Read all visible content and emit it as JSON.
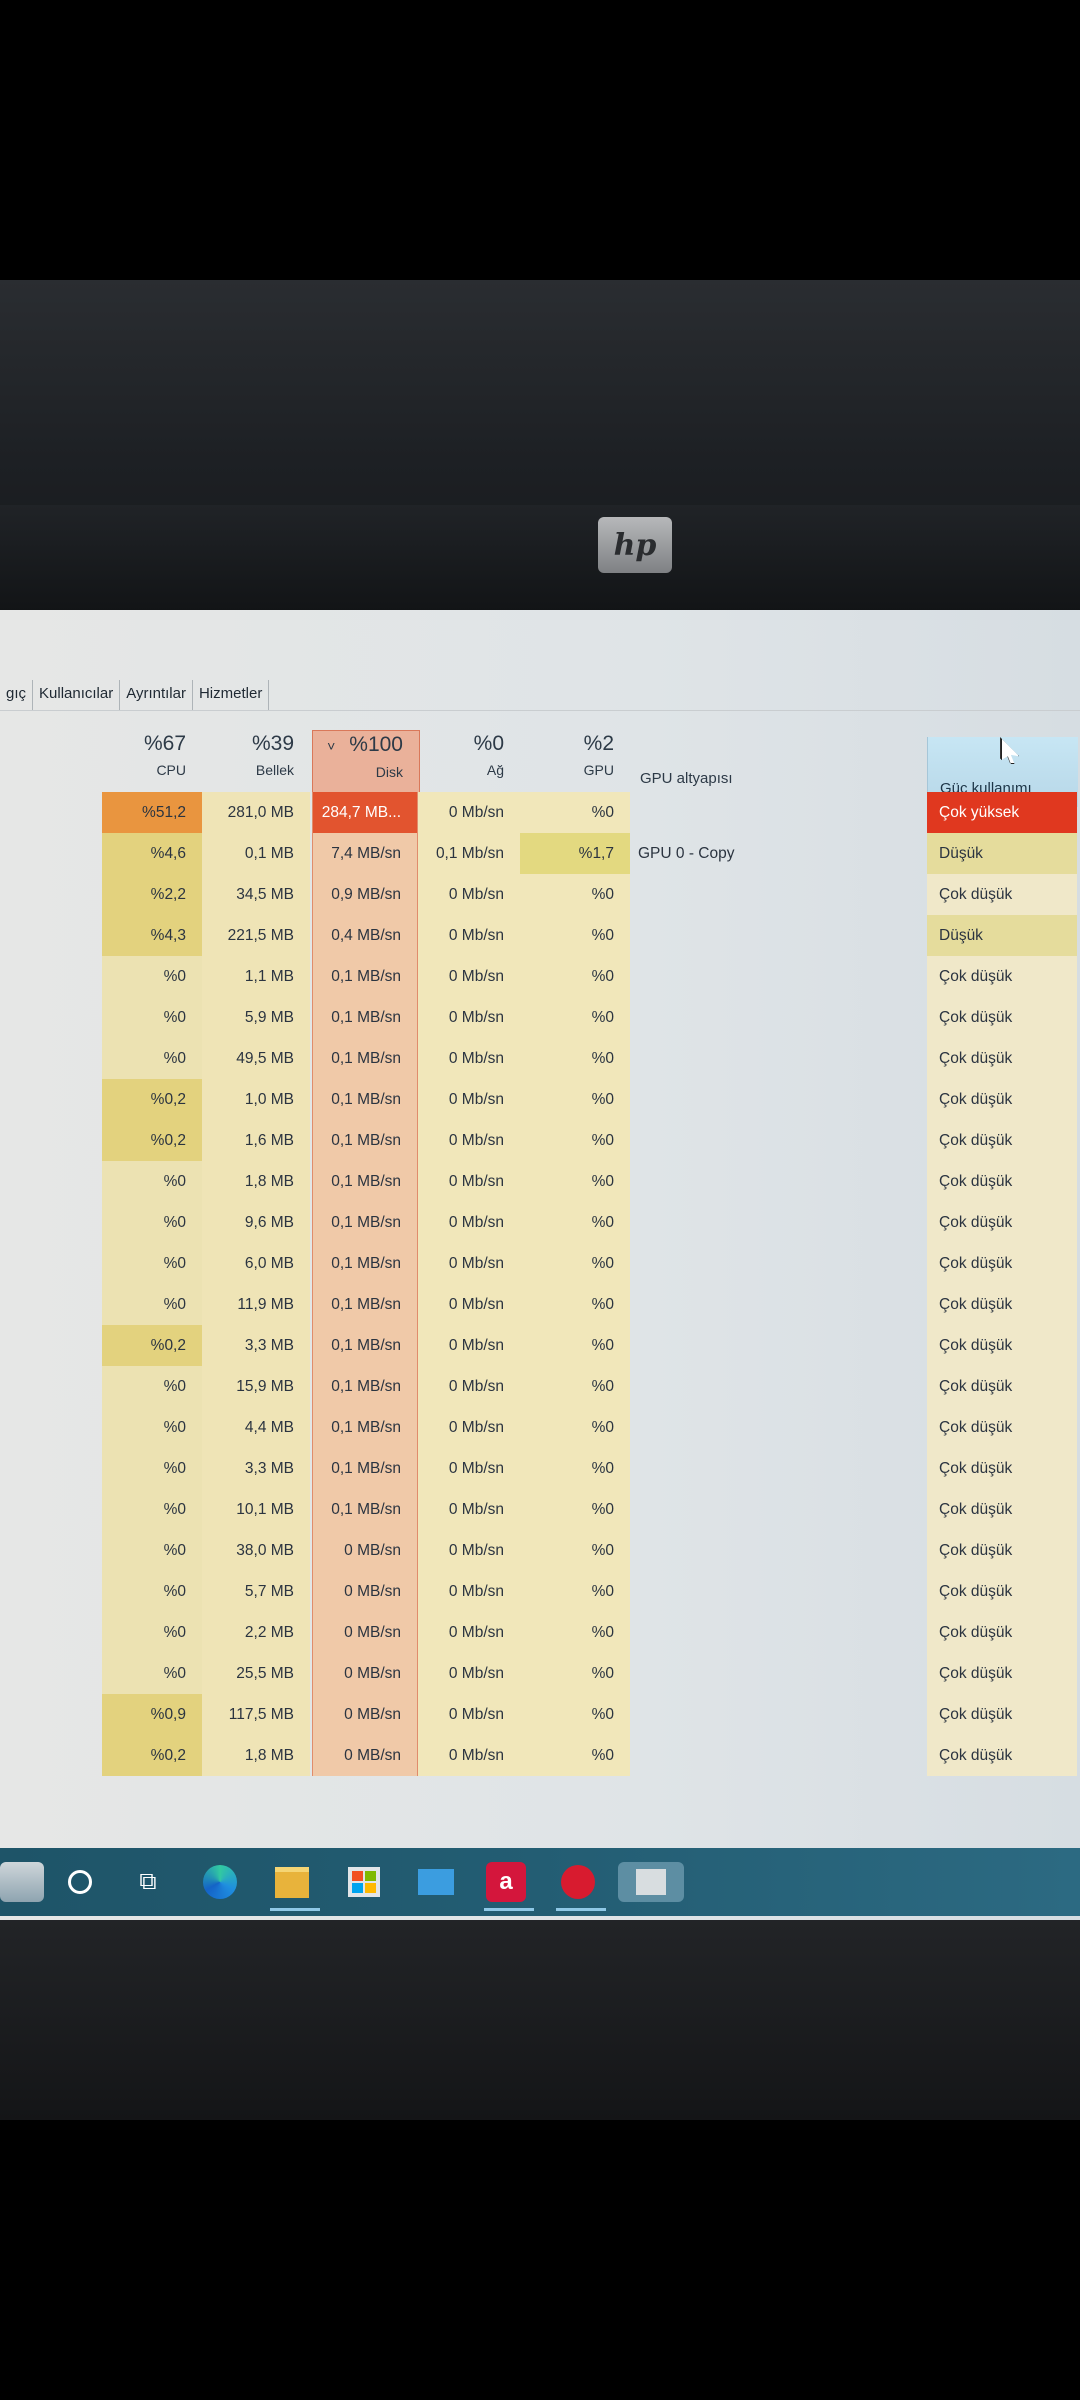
{
  "brand": "hp",
  "tabs": [
    "gıç",
    "Kullanıcılar",
    "Ayrıntılar",
    "Hizmetler"
  ],
  "columns": {
    "cpu": {
      "pct": "%67",
      "label": "CPU"
    },
    "memory": {
      "pct": "%39",
      "label": "Bellek"
    },
    "disk": {
      "pct": "%100",
      "label": "Disk",
      "sort": "˅"
    },
    "network": {
      "pct": "%0",
      "label": "Ağ"
    },
    "gpu": {
      "pct": "%2",
      "label": "GPU"
    },
    "gpu_engine": {
      "label": "GPU altyapısı"
    },
    "power": {
      "label": "Güç kullanımı"
    }
  },
  "rows": [
    {
      "cpu": "%51,2",
      "mem": "281,0 MB",
      "disk": "284,7 MB...",
      "net": "0 Mb/sn",
      "gpu": "%0",
      "engine": "",
      "power": "Çok yüksek"
    },
    {
      "cpu": "%4,6",
      "mem": "0,1 MB",
      "disk": "7,4 MB/sn",
      "net": "0,1 Mb/sn",
      "gpu": "%1,7",
      "engine": "GPU 0 - Copy",
      "power": "Düşük"
    },
    {
      "cpu": "%2,2",
      "mem": "34,5 MB",
      "disk": "0,9 MB/sn",
      "net": "0 Mb/sn",
      "gpu": "%0",
      "engine": "",
      "power": "Çok düşük"
    },
    {
      "cpu": "%4,3",
      "mem": "221,5 MB",
      "disk": "0,4 MB/sn",
      "net": "0 Mb/sn",
      "gpu": "%0",
      "engine": "",
      "power": "Düşük"
    },
    {
      "cpu": "%0",
      "mem": "1,1 MB",
      "disk": "0,1 MB/sn",
      "net": "0 Mb/sn",
      "gpu": "%0",
      "engine": "",
      "power": "Çok düşük"
    },
    {
      "cpu": "%0",
      "mem": "5,9 MB",
      "disk": "0,1 MB/sn",
      "net": "0 Mb/sn",
      "gpu": "%0",
      "engine": "",
      "power": "Çok düşük"
    },
    {
      "cpu": "%0",
      "mem": "49,5 MB",
      "disk": "0,1 MB/sn",
      "net": "0 Mb/sn",
      "gpu": "%0",
      "engine": "",
      "power": "Çok düşük"
    },
    {
      "cpu": "%0,2",
      "mem": "1,0 MB",
      "disk": "0,1 MB/sn",
      "net": "0 Mb/sn",
      "gpu": "%0",
      "engine": "",
      "power": "Çok düşük"
    },
    {
      "cpu": "%0,2",
      "mem": "1,6 MB",
      "disk": "0,1 MB/sn",
      "net": "0 Mb/sn",
      "gpu": "%0",
      "engine": "",
      "power": "Çok düşük"
    },
    {
      "cpu": "%0",
      "mem": "1,8 MB",
      "disk": "0,1 MB/sn",
      "net": "0 Mb/sn",
      "gpu": "%0",
      "engine": "",
      "power": "Çok düşük"
    },
    {
      "cpu": "%0",
      "mem": "9,6 MB",
      "disk": "0,1 MB/sn",
      "net": "0 Mb/sn",
      "gpu": "%0",
      "engine": "",
      "power": "Çok düşük"
    },
    {
      "cpu": "%0",
      "mem": "6,0 MB",
      "disk": "0,1 MB/sn",
      "net": "0 Mb/sn",
      "gpu": "%0",
      "engine": "",
      "power": "Çok düşük"
    },
    {
      "cpu": "%0",
      "mem": "11,9 MB",
      "disk": "0,1 MB/sn",
      "net": "0 Mb/sn",
      "gpu": "%0",
      "engine": "",
      "power": "Çok düşük"
    },
    {
      "cpu": "%0,2",
      "mem": "3,3 MB",
      "disk": "0,1 MB/sn",
      "net": "0 Mb/sn",
      "gpu": "%0",
      "engine": "",
      "power": "Çok düşük"
    },
    {
      "cpu": "%0",
      "mem": "15,9 MB",
      "disk": "0,1 MB/sn",
      "net": "0 Mb/sn",
      "gpu": "%0",
      "engine": "",
      "power": "Çok düşük"
    },
    {
      "cpu": "%0",
      "mem": "4,4 MB",
      "disk": "0,1 MB/sn",
      "net": "0 Mb/sn",
      "gpu": "%0",
      "engine": "",
      "power": "Çok düşük"
    },
    {
      "cpu": "%0",
      "mem": "3,3 MB",
      "disk": "0,1 MB/sn",
      "net": "0 Mb/sn",
      "gpu": "%0",
      "engine": "",
      "power": "Çok düşük"
    },
    {
      "cpu": "%0",
      "mem": "10,1 MB",
      "disk": "0,1 MB/sn",
      "net": "0 Mb/sn",
      "gpu": "%0",
      "engine": "",
      "power": "Çok düşük"
    },
    {
      "cpu": "%0",
      "mem": "38,0 MB",
      "disk": "0 MB/sn",
      "net": "0 Mb/sn",
      "gpu": "%0",
      "engine": "",
      "power": "Çok düşük"
    },
    {
      "cpu": "%0",
      "mem": "5,7 MB",
      "disk": "0 MB/sn",
      "net": "0 Mb/sn",
      "gpu": "%0",
      "engine": "",
      "power": "Çok düşük"
    },
    {
      "cpu": "%0",
      "mem": "2,2 MB",
      "disk": "0 MB/sn",
      "net": "0 Mb/sn",
      "gpu": "%0",
      "engine": "",
      "power": "Çok düşük"
    },
    {
      "cpu": "%0",
      "mem": "25,5 MB",
      "disk": "0 MB/sn",
      "net": "0 Mb/sn",
      "gpu": "%0",
      "engine": "",
      "power": "Çok düşük"
    },
    {
      "cpu": "%0,9",
      "mem": "117,5 MB",
      "disk": "0 MB/sn",
      "net": "0 Mb/sn",
      "gpu": "%0",
      "engine": "",
      "power": "Çok düşük"
    },
    {
      "cpu": "%0,2",
      "mem": "1,8 MB",
      "disk": "0 MB/sn",
      "net": "0 Mb/sn",
      "gpu": "%0",
      "engine": "",
      "power": "Çok düşük"
    }
  ],
  "colors": {
    "cpu_high": "#e9953f",
    "cpu_mid": "#e3d27e",
    "cpu_low": "#ece2b2",
    "disk_high": "#e2542f",
    "disk_fill": "#f0c9a8",
    "mem_fill": "#efe4b6",
    "net_fill": "#f1e7ba",
    "gpu_fill": "#f1e7ba",
    "gpu_high": "#e3d980",
    "power_very_high": "#e0381f",
    "power_low": "#e5dc9c",
    "power_very_low": "#f0e8c9"
  },
  "taskbar": {
    "icons": [
      "cortana-icon",
      "task-view-icon",
      "edge-icon",
      "file-explorer-icon",
      "store-icon",
      "mail-icon",
      "amd-icon",
      "red-app-icon",
      "app-icon"
    ]
  }
}
